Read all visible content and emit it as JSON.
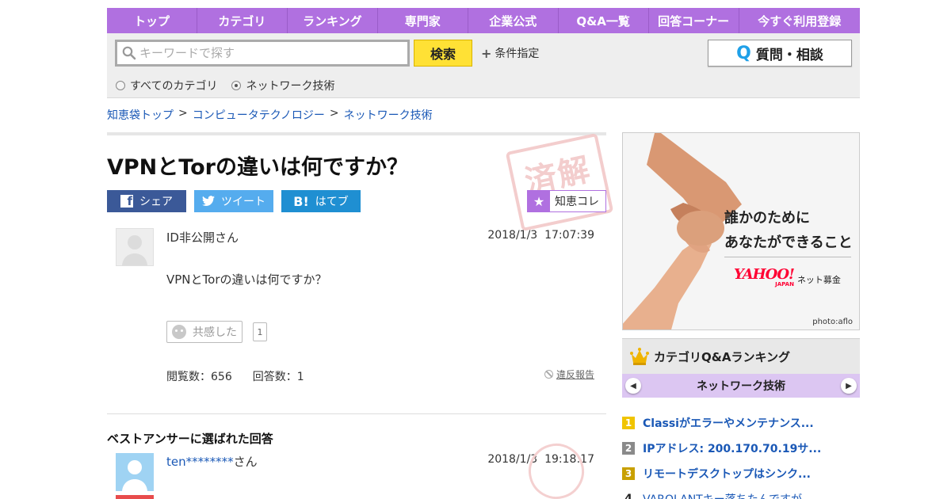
{
  "nav": {
    "items": [
      "トップ",
      "カテゴリ",
      "ランキング",
      "専門家",
      "企業公式",
      "Q&A一覧",
      "回答コーナー",
      "今すぐ利用登録"
    ]
  },
  "search": {
    "placeholder": "キーワードで探す",
    "button_label": "検索",
    "condition_label": "条件指定",
    "ask_button_label": "質問・相談",
    "ask_q": "Q",
    "radio_all": "すべてのカテゴリ",
    "radio_current": "ネットワーク技術",
    "selected_radio": "ネットワーク技術"
  },
  "breadcrumb": {
    "items": [
      "知恵袋トップ",
      "コンピュータテクノロジー",
      "ネットワーク技術"
    ],
    "sep": ">"
  },
  "question": {
    "title": "VPNとTorの違いは何ですか？",
    "seal_text": "済解",
    "user": "ID非公開さん",
    "date": "2018/1/3",
    "time": "17:07:39",
    "body": "VPNとTorの違いは何ですか？",
    "kyokan_label": "共感した",
    "kyokan_count": "1",
    "views_label": "閲覧数：656",
    "answers_label": "回答数：1",
    "report_label": "違反報告"
  },
  "share": {
    "facebook": "シェア",
    "twitter": "ツイート",
    "hatena": "はてブ",
    "hatena_icon": "B!",
    "chie_colle": "知恵コレ"
  },
  "best_answer": {
    "heading": "ベストアンサーに選ばれた回答",
    "user_id": "ten********",
    "user_suffix": "さん",
    "date": "2018/1/3",
    "time": "19:18:17"
  },
  "ad": {
    "line1": "誰かのために",
    "line2": "あなたができること",
    "brand": "YAHOO!",
    "brand_sub": "ネット募金",
    "brand_sub_small": "JAPAN",
    "credit": "photo:aflo"
  },
  "ranking": {
    "heading": "カテゴリQ&Aランキング",
    "category": "ネットワーク技術",
    "items": [
      {
        "rank": "1",
        "title": "Classiがエラーやメンテナンス..."
      },
      {
        "rank": "2",
        "title": "IPアドレス: 200.170.70.19サ..."
      },
      {
        "rank": "3",
        "title": "リモートデスクトップはシンク..."
      },
      {
        "rank": "4",
        "title": "VAROLANTキー落ちたんですが、..."
      }
    ]
  },
  "colors": {
    "nav_purple": "#b070e0",
    "search_yellow": "#ffe135",
    "link_blue": "#1a58b6",
    "facebook": "#3b5998",
    "twitter": "#55acee",
    "hatena": "#1f8fd2"
  }
}
